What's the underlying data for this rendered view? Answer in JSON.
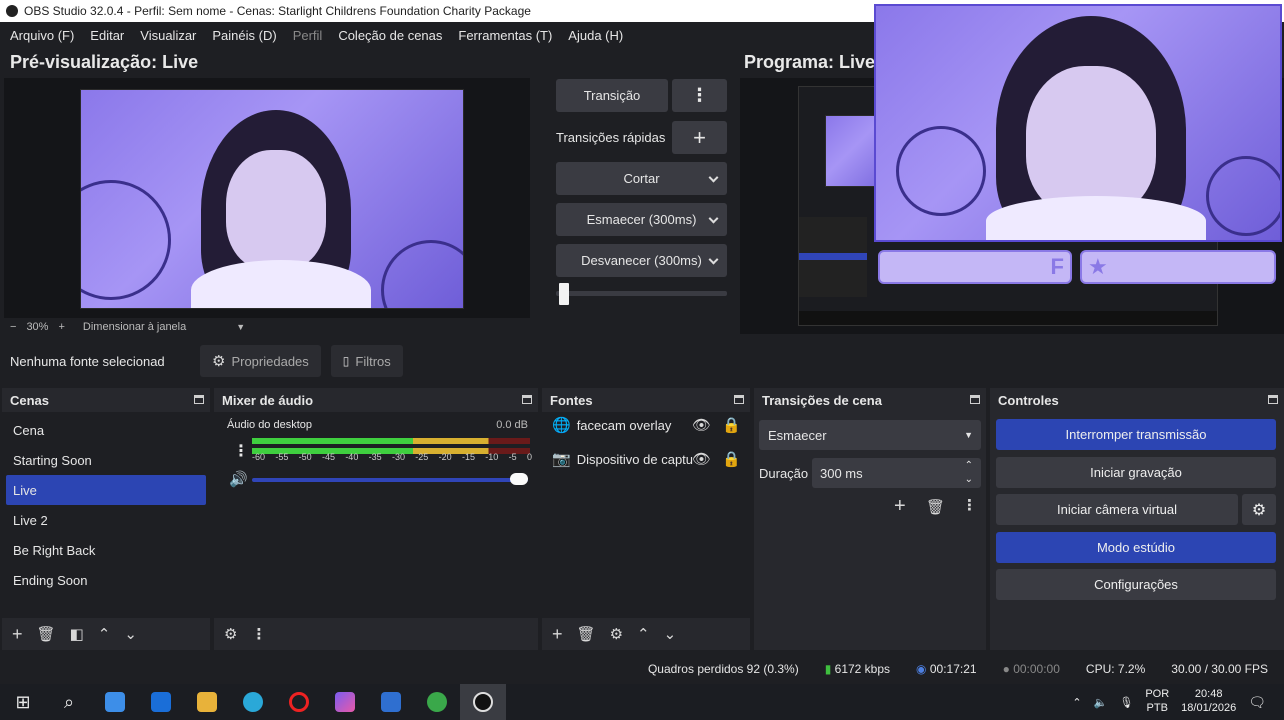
{
  "window": {
    "title": "OBS Studio 32.0.4 - Perfil: Sem nome - Cenas: Starlight Childrens Foundation Charity Package"
  },
  "menu": [
    "Arquivo (F)",
    "Editar",
    "Visualizar",
    "Painéis (D)",
    "Perfil",
    "Coleção de cenas",
    "Ferramentas (T)",
    "Ajuda (H)"
  ],
  "preview": {
    "title": "Pré-visualização: Live",
    "zoom": "30%",
    "zoom_minus": "−",
    "zoom_plus": "+",
    "resize_mode": "Dimensionar à janela"
  },
  "program": {
    "title": "Programa: Live",
    "badge_letter": "F",
    "badge_star": "★"
  },
  "transitions_panel": {
    "transition_button": "Transição",
    "quick_label": "Transições rápidas",
    "cut": "Cortar",
    "fade": "Esmaecer (300ms)",
    "fade_out": "Desvanecer (300ms)",
    "position": 0.02
  },
  "source_bar": {
    "no_source": "Nenhuma fonte selecionad",
    "properties": "Propriedades",
    "filters": "Filtros"
  },
  "scenes": {
    "title": "Cenas",
    "items": [
      "Cena",
      "Starting Soon",
      "Live",
      "Live 2",
      "Be Right Back",
      "Ending Soon"
    ],
    "selected": "Live"
  },
  "mixer": {
    "title": "Mixer de áudio",
    "track": "Áudio do desktop",
    "db": "0.0 dB",
    "ticks": [
      "-60",
      "-55",
      "-50",
      "-45",
      "-40",
      "-35",
      "-30",
      "-25",
      "-20",
      "-15",
      "-10",
      "-5",
      "0"
    ],
    "volume": 1.0,
    "meter_level": 0.85
  },
  "sources": {
    "title": "Fontes",
    "items": [
      {
        "name": "facecam overlay",
        "icon": "globe-icon"
      },
      {
        "name": "Dispositivo de captu",
        "icon": "camera-icon"
      }
    ]
  },
  "scene_transitions": {
    "title": "Transições de cena",
    "selected": "Esmaecer",
    "duration_label": "Duração",
    "duration_value": "300 ms"
  },
  "controls": {
    "title": "Controles",
    "stop_stream": "Interromper transmissão",
    "start_recording": "Iniciar gravação",
    "start_virtual_cam": "Iniciar câmera virtual",
    "studio_mode": "Modo estúdio",
    "settings": "Configurações"
  },
  "status": {
    "dropped": "Quadros perdidos 92 (0.3%)",
    "bitrate": "6172 kbps",
    "stream_time": "00:17:21",
    "record_time": "00:00:00",
    "cpu": "CPU: 7.2%",
    "fps": "30.00 / 30.00 FPS"
  },
  "taskbar": {
    "lang_top": "POR",
    "lang_bottom": "PTB",
    "time": "20:48",
    "date": "18/01/2026"
  },
  "colors": {
    "accent": "#2c45b3",
    "bg": "#1e1f23",
    "panel": "#27282d",
    "button": "#3a3b42"
  }
}
